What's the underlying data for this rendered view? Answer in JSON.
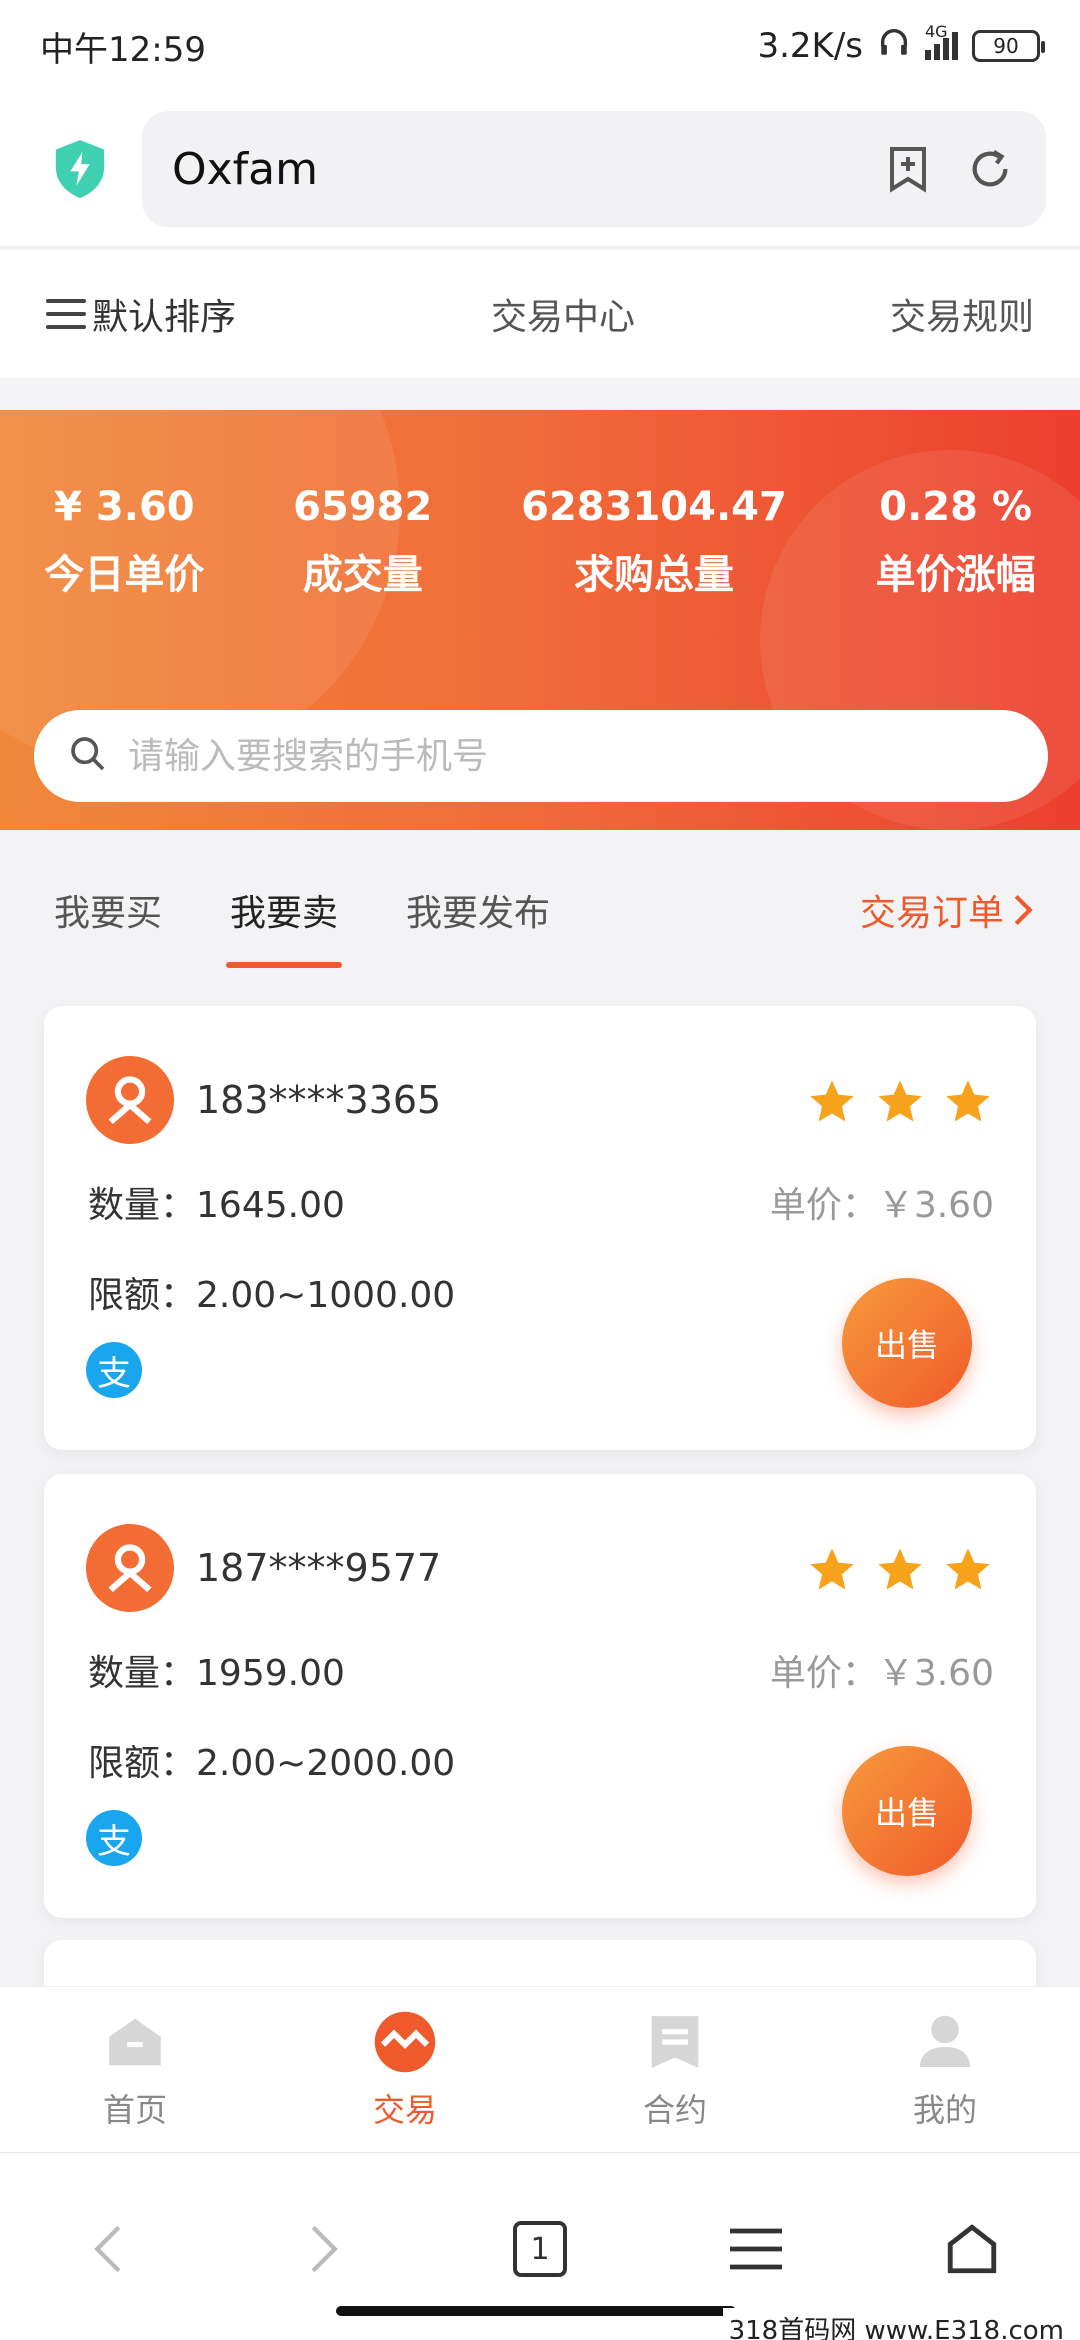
{
  "status_bar": {
    "time": "中午12:59",
    "network_speed": "3.2K/s",
    "signal": "4G",
    "battery": "90"
  },
  "browser": {
    "url": "Oxfam"
  },
  "top_nav": {
    "sort": "默认排序",
    "center": "交易中心",
    "rules": "交易规则"
  },
  "hero": {
    "stats": [
      {
        "value": "¥ 3.60",
        "label": "今日单价"
      },
      {
        "value": "65982",
        "label": "成交量"
      },
      {
        "value": "6283104.47",
        "label": "求购总量"
      },
      {
        "value": "0.28 %",
        "label": "单价涨幅"
      }
    ],
    "search_placeholder": "请输入要搜索的手机号",
    "colors": {
      "start": "#f0883a",
      "end": "#ec3f2e"
    }
  },
  "tabs": {
    "items": [
      "我要买",
      "我要卖",
      "我要发布"
    ],
    "active": "我要卖",
    "orders": "交易订单"
  },
  "listings": [
    {
      "phone": "183****3365",
      "stars": 3,
      "qty_label": "数量：",
      "qty": "1645.00",
      "price_label": "单价：",
      "price": "￥3.60",
      "limit_label": "限额：",
      "limit": "2.00~1000.00",
      "pay_glyph": "支",
      "action": "出售"
    },
    {
      "phone": "187****9577",
      "stars": 3,
      "qty_label": "数量：",
      "qty": "1959.00",
      "price_label": "单价：",
      "price": "￥3.60",
      "limit_label": "限额：",
      "limit": "2.00~2000.00",
      "pay_glyph": "支",
      "action": "出售"
    }
  ],
  "app_tabs": [
    {
      "label": "首页",
      "icon": "home-icon"
    },
    {
      "label": "交易",
      "icon": "trade-icon",
      "active": true
    },
    {
      "label": "合约",
      "icon": "contract-icon"
    },
    {
      "label": "我的",
      "icon": "profile-icon"
    }
  ],
  "browser_nav": {
    "tab_count": "1"
  },
  "watermark": "318首码网 www.E318.com",
  "accent_color": "#ee5a2c"
}
